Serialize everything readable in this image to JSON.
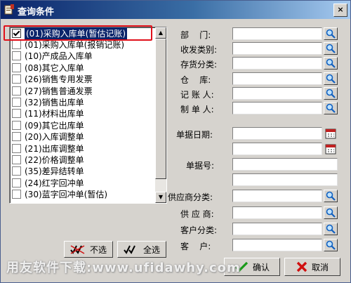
{
  "window": {
    "title": "查询条件",
    "close_label": "×"
  },
  "document_types": [
    {
      "label": "(01)采购入库单(暂估记账)",
      "checked": true,
      "selected": true
    },
    {
      "label": "(01)采购入库单(报销记账)",
      "checked": false
    },
    {
      "label": "(10)产成品入库单",
      "checked": false
    },
    {
      "label": "(08)其它入库单",
      "checked": false
    },
    {
      "label": "(26)销售专用发票",
      "checked": false
    },
    {
      "label": "(27)销售普通发票",
      "checked": false
    },
    {
      "label": "(32)销售出库单",
      "checked": false
    },
    {
      "label": "(11)材料出库单",
      "checked": false
    },
    {
      "label": "(09)其它出库单",
      "checked": false
    },
    {
      "label": "(20)入库调整单",
      "checked": false
    },
    {
      "label": "(21)出库调整单",
      "checked": false
    },
    {
      "label": "(22)价格调整单",
      "checked": false
    },
    {
      "label": "(35)差异结转单",
      "checked": false
    },
    {
      "label": "(24)红字回冲单",
      "checked": false
    },
    {
      "label": "(30)蓝字回冲单(暂估)",
      "checked": false
    }
  ],
  "buttons": {
    "deselect_all": "不选",
    "select_all": "全选",
    "confirm": "确认",
    "cancel": "取消"
  },
  "fields": {
    "department": {
      "label": "部    门:",
      "value": ""
    },
    "receive_send_category": {
      "label": "收发类别:",
      "value": ""
    },
    "inventory_category": {
      "label": "存货分类:",
      "value": ""
    },
    "warehouse": {
      "label": "仓    库:",
      "value": ""
    },
    "bookkeeper": {
      "label": "记 账 人:",
      "value": ""
    },
    "preparer": {
      "label": "制 单 人:",
      "value": ""
    },
    "doc_date": {
      "label": "单据日期:",
      "value_from": "",
      "value_to": ""
    },
    "doc_number": {
      "label": "单据号:",
      "value_from": "",
      "value_to": ""
    },
    "supplier_category": {
      "label": "供应商分类:",
      "value": ""
    },
    "supplier": {
      "label": "供 应 商:",
      "value": ""
    },
    "customer_category": {
      "label": "客户分类:",
      "value": ""
    },
    "customer": {
      "label": "客    户:",
      "value": ""
    }
  },
  "watermark": "用友软件下载:www.ufidawhy.com"
}
